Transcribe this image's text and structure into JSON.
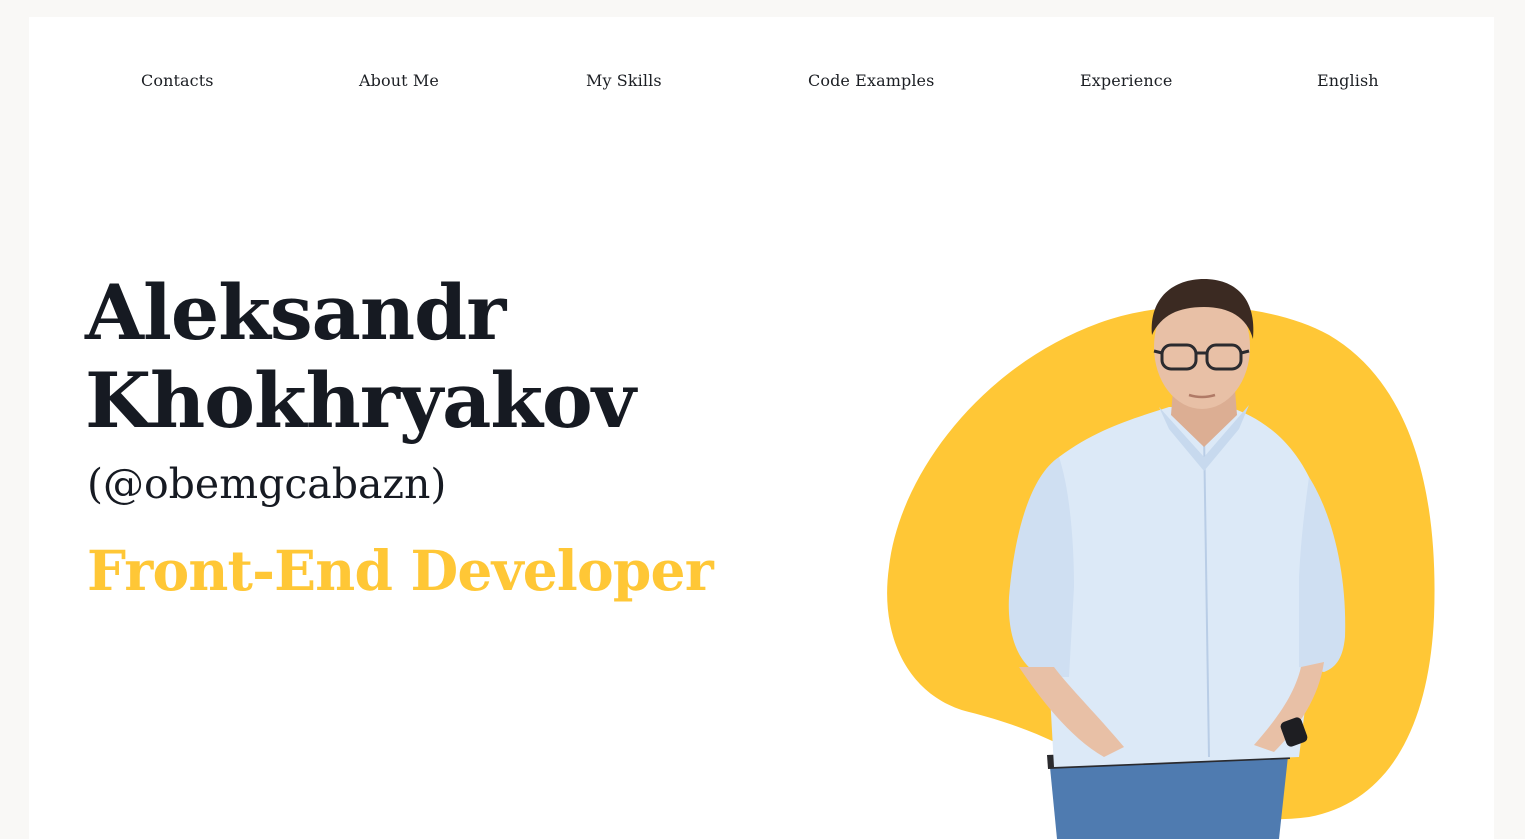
{
  "nav": {
    "items": [
      {
        "label": "Contacts"
      },
      {
        "label": "About Me"
      },
      {
        "label": "My Skills"
      },
      {
        "label": "Code Examples"
      },
      {
        "label": "Experience"
      },
      {
        "label": "English"
      }
    ]
  },
  "hero": {
    "name_line1": "Aleksandr",
    "name_line2": "Khokhryakov",
    "handle": "(@obemgcabazn)",
    "role": "Front-End Developer"
  },
  "colors": {
    "accent": "#ffc736",
    "text": "#161a22",
    "background": "#ffffff",
    "page_bg": "#f9f8f6",
    "shirt": "#dce9f7",
    "jeans": "#4f7bb0",
    "skin": "#e8c0a6",
    "hair": "#3b2a22"
  }
}
